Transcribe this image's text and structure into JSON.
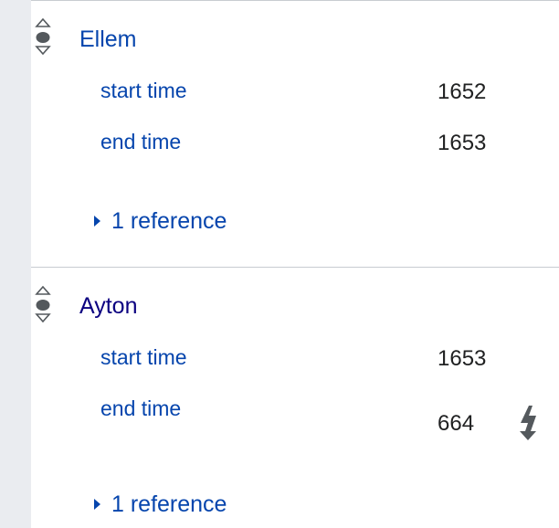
{
  "statements": [
    {
      "value": "Ellem",
      "qualifiers": [
        {
          "property": "start time",
          "value": "1652"
        },
        {
          "property": "end time",
          "value": "1653"
        }
      ],
      "references": "1 reference",
      "rank_icon": "normal-rank-icon"
    },
    {
      "value": "Ayton",
      "qualifiers": [
        {
          "property": "start time",
          "value": "1653"
        },
        {
          "property": "end time",
          "value": "664",
          "warning_icon": "constraint-violation-icon"
        }
      ],
      "references": "1 reference",
      "rank_icon": "normal-rank-icon"
    }
  ],
  "colors": {
    "link": "#0645ad",
    "visited_link": "#0b0080",
    "text": "#202122",
    "gutter": "#eaecf0",
    "divider": "#c8ccd1",
    "icon": "#54595d"
  }
}
